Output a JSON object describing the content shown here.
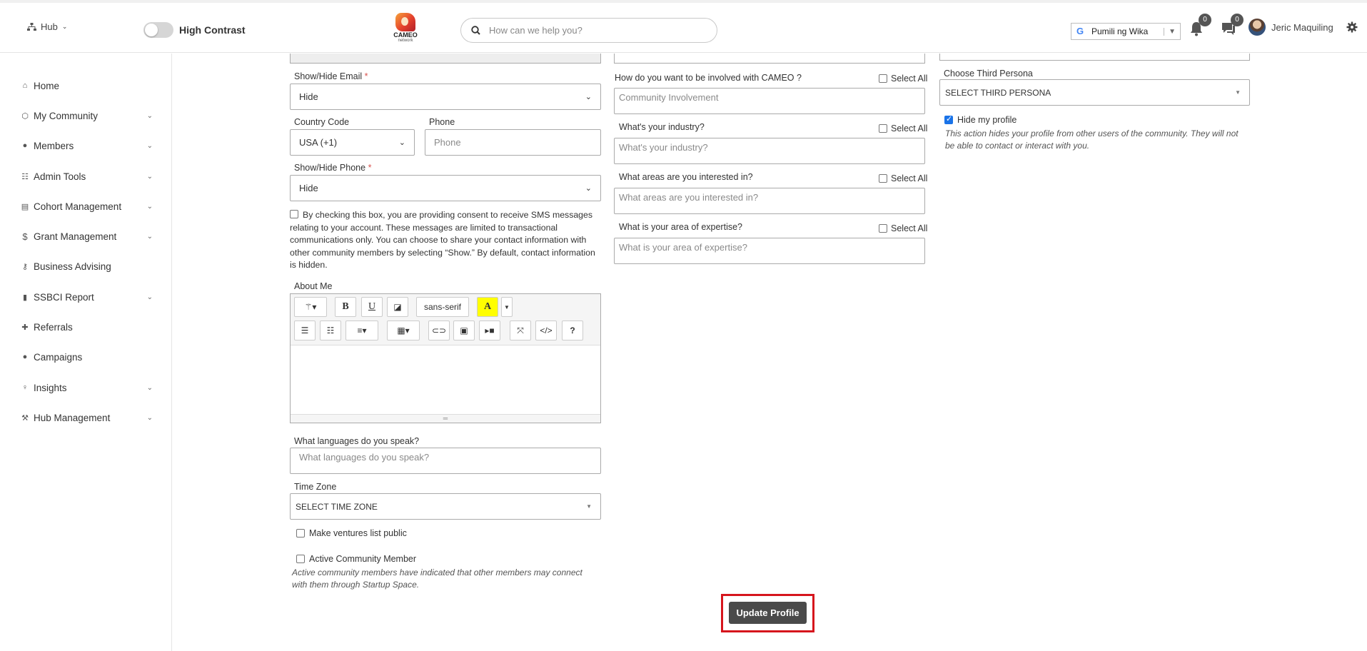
{
  "topbar": {
    "hub_label": "Hub",
    "high_contrast_label": "High Contrast",
    "logo_word": "CAMEO",
    "logo_sub": "network",
    "search_placeholder": "How can we help you?",
    "language_label": "Pumili ng Wika",
    "notifications_count": "0",
    "messages_count": "0",
    "user_name": "Jeric Maquiling"
  },
  "sidebar": {
    "items": [
      {
        "label": "Home",
        "icon": "home-icon",
        "has_children": false
      },
      {
        "label": "My Community",
        "icon": "community-icon",
        "has_children": true
      },
      {
        "label": "Members",
        "icon": "user-circle-icon",
        "has_children": true
      },
      {
        "label": "Admin Tools",
        "icon": "tools-icon",
        "has_children": true
      },
      {
        "label": "Cohort Management",
        "icon": "table-icon",
        "has_children": true
      },
      {
        "label": "Grant Management",
        "icon": "dollar-icon",
        "has_children": true
      },
      {
        "label": "Business Advising",
        "icon": "key-icon",
        "has_children": false
      },
      {
        "label": "SSBCI Report",
        "icon": "file-icon",
        "has_children": true
      },
      {
        "label": "Referrals",
        "icon": "user-plus-icon",
        "has_children": false
      },
      {
        "label": "Campaigns",
        "icon": "comment-icon",
        "has_children": false
      },
      {
        "label": "Insights",
        "icon": "lightbulb-icon",
        "has_children": true
      },
      {
        "label": "Hub Management",
        "icon": "wrench-icon",
        "has_children": true
      }
    ]
  },
  "col1": {
    "show_email_label": "Show/Hide Email",
    "show_email_value": "Hide",
    "country_code_label": "Country Code",
    "country_code_value": "USA (+1)",
    "phone_label": "Phone",
    "phone_placeholder": "Phone",
    "show_phone_label": "Show/Hide Phone",
    "show_phone_value": "Hide",
    "consent_text": "By checking this box, you are providing consent to receive SMS messages relating to your account. These messages are limited to transactional communications only. You can choose to share your contact information with other community members by selecting “Show.” By default, contact information is hidden.",
    "about_me_label": "About Me",
    "font_label": "sans-serif",
    "languages_label": "What languages do you speak?",
    "languages_placeholder": "What languages do you speak?",
    "timezone_label": "Time Zone",
    "timezone_value": "SELECT TIME ZONE",
    "ventures_public_label": "Make ventures list public",
    "active_member_label": "Active Community Member",
    "active_member_note": "Active community members have indicated that other members may connect with them through Startup Space."
  },
  "col2": {
    "involved_label": "How do you want to be involved with CAMEO ?",
    "involved_placeholder": "Community Involvement",
    "industry_label": "What's your industry?",
    "industry_placeholder": "What's your industry?",
    "interests_label": "What areas are you interested in?",
    "interests_placeholder": "What areas are you interested in?",
    "expertise_label": "What is your area of expertise?",
    "expertise_placeholder": "What is your area of expertise?",
    "select_all_label": "Select All"
  },
  "col3": {
    "third_persona_label": "Choose Third Persona",
    "third_persona_value": "SELECT THIRD PERSONA",
    "hide_profile_label": "Hide my profile",
    "hide_profile_checked": true,
    "hide_profile_note": "This action hides your profile from other users of the community. They will not be able to contact or interact with you."
  },
  "actions": {
    "update_label": "Update Profile"
  },
  "colors": {
    "highlight": "#d6151d",
    "update_button": "#4a4a4a",
    "required": "#d9534f"
  }
}
